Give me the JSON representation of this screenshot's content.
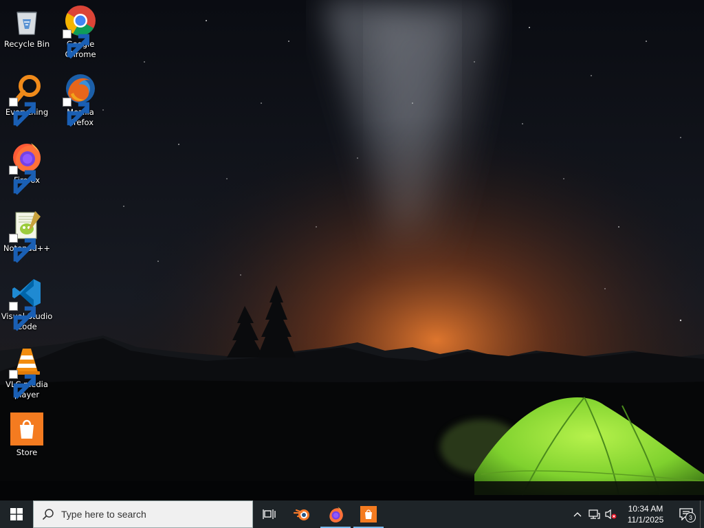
{
  "desktop": {
    "wallpaper": "night-sky-milky-way-green-tent",
    "icons": [
      {
        "label": "Recycle Bin",
        "icon": "recycle-bin-icon",
        "shortcut": false
      },
      {
        "label": "Google\nChrome",
        "icon": "chrome-icon",
        "shortcut": true
      },
      {
        "label": "Everything",
        "icon": "everything-search-icon",
        "shortcut": true
      },
      {
        "label": "Mozilla\nFirefox",
        "icon": "firefox-legacy-icon",
        "shortcut": true
      },
      {
        "label": "Firefox",
        "icon": "firefox-icon",
        "shortcut": true
      },
      {
        "label": "Notepad++",
        "icon": "notepad-plus-plus-icon",
        "shortcut": true
      },
      {
        "label": "Visual Studio\nCode",
        "icon": "vscode-icon",
        "shortcut": true
      },
      {
        "label": "VLC media\nplayer",
        "icon": "vlc-icon",
        "shortcut": true
      },
      {
        "label": "Store",
        "icon": "store-icon",
        "shortcut": false
      }
    ]
  },
  "taskbar": {
    "search_placeholder": "Type here to search",
    "pinned": [
      {
        "name": "task-view-button",
        "icon": "task-view-icon"
      },
      {
        "name": "blender-button",
        "icon": "blender-icon"
      },
      {
        "name": "firefox-taskbar-button",
        "icon": "firefox-icon",
        "active": true
      },
      {
        "name": "store-taskbar-button",
        "icon": "store-icon",
        "active": true
      }
    ],
    "tray": {
      "clock_time": "10:34 AM",
      "clock_date": "11/1/2025",
      "notification_count": "3"
    }
  },
  "colors": {
    "taskbar_bg": "#1e2428",
    "accent": "#76b9ed",
    "tent_green": "#8fe03a",
    "horizon_glow": "#e0702a"
  }
}
